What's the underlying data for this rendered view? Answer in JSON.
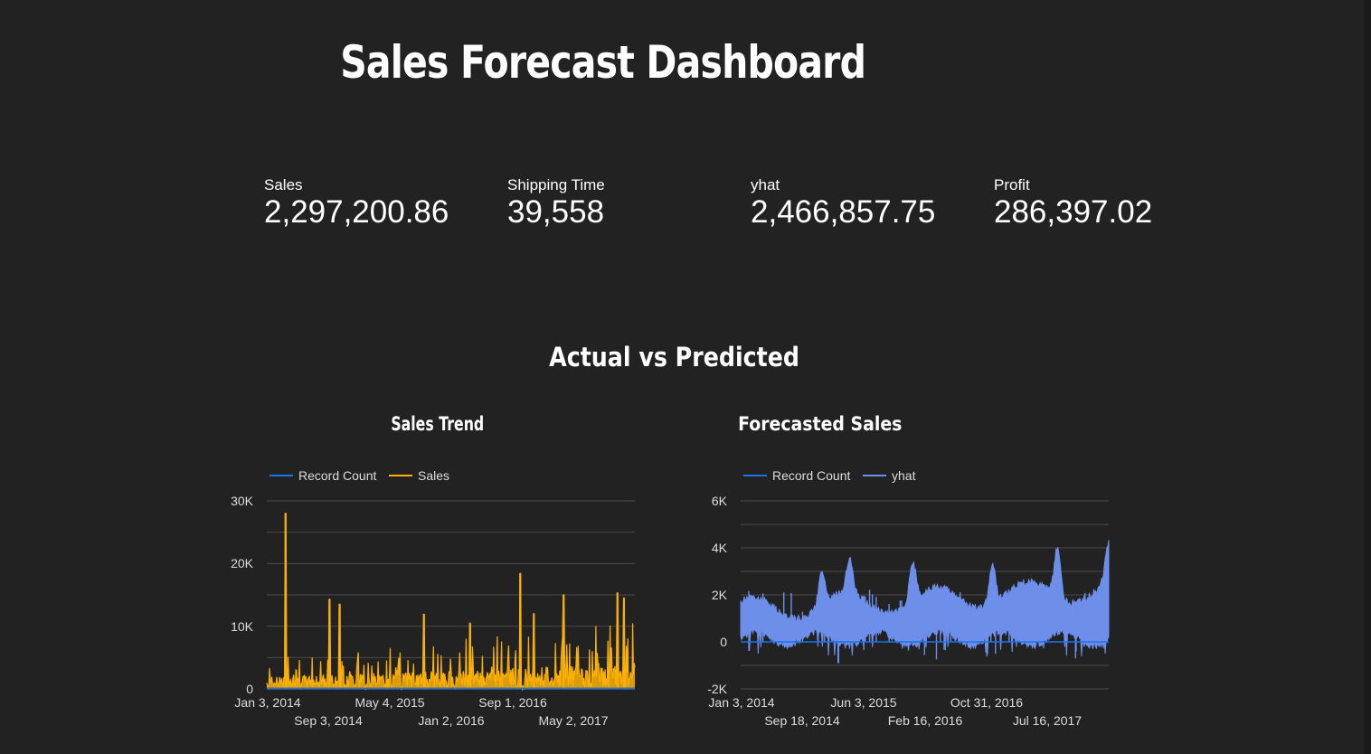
{
  "dashboard": {
    "title": "Sales Forecast Dashboard",
    "section_title": "Actual vs Predicted",
    "background": "#222222"
  },
  "kpis": [
    {
      "label": "Sales",
      "value": "2,297,200.86"
    },
    {
      "label": "Shipping Time",
      "value": "39,558"
    },
    {
      "label": "yhat",
      "value": "2,466,857.75"
    },
    {
      "label": "Profit",
      "value": "286,397.02"
    }
  ],
  "chart_data": [
    {
      "type": "line",
      "title": "Sales Trend",
      "legend_position": "top-left",
      "series": [
        {
          "name": "Record Count",
          "color": "#1a73e8"
        },
        {
          "name": "Sales",
          "color": "#fbb104"
        }
      ],
      "x_range": [
        "Jan 3, 2014",
        "Dec 30, 2017"
      ],
      "ylim": [
        0,
        30000
      ],
      "y_ticks": [
        "0",
        "10K",
        "20K",
        "30K"
      ],
      "x_ticks_row1": [
        "Jan 3, 2014",
        "May 4, 2015",
        "Sep 1, 2016"
      ],
      "x_ticks_row2": [
        "Sep 3, 2014",
        "Jan 2, 2016",
        "May 2, 2017"
      ],
      "sales_peaks": [
        {
          "date": "2014-03-18",
          "value": 28000
        },
        {
          "date": "2014-09-08",
          "value": 14300
        },
        {
          "date": "2014-10-19",
          "value": 13500
        },
        {
          "date": "2015-09-17",
          "value": 11900
        },
        {
          "date": "2016-03-18",
          "value": 10500
        },
        {
          "date": "2016-10-02",
          "value": 18400
        },
        {
          "date": "2016-11-25",
          "value": 12000
        },
        {
          "date": "2017-03-23",
          "value": 15000
        },
        {
          "date": "2017-10-22",
          "value": 15300
        },
        {
          "date": "2017-11-17",
          "value": 14500
        }
      ],
      "record_count_level": 100,
      "grid": true
    },
    {
      "type": "area",
      "title": "Forecasted Sales",
      "legend_position": "top-left",
      "series": [
        {
          "name": "Record Count",
          "color": "#1a73e8"
        },
        {
          "name": "yhat",
          "color": "#6d8fea"
        }
      ],
      "x_range": [
        "Jan 3, 2014",
        "Dec 30, 2017"
      ],
      "ylim": [
        -2000,
        6000
      ],
      "y_ticks": [
        "-2K",
        "0",
        "2K",
        "4K",
        "6K"
      ],
      "x_ticks_row1": [
        "Jan 3, 2014",
        "Jun 3, 2015",
        "Oct 31, 2016"
      ],
      "x_ticks_row2": [
        "Sep 18, 2014",
        "Feb 16, 2016",
        "Jul 16, 2017"
      ],
      "yhat_upper_peaks": [
        {
          "date": "2014-11-20",
          "value": 3200
        },
        {
          "date": "2015-03-10",
          "value": 3300
        },
        {
          "date": "2015-11-15",
          "value": 3400
        },
        {
          "date": "2016-09-25",
          "value": 3500
        },
        {
          "date": "2017-06-10",
          "value": 3900
        },
        {
          "date": "2017-12-28",
          "value": 3400
        }
      ],
      "yhat_min": -900,
      "grid": true
    }
  ]
}
